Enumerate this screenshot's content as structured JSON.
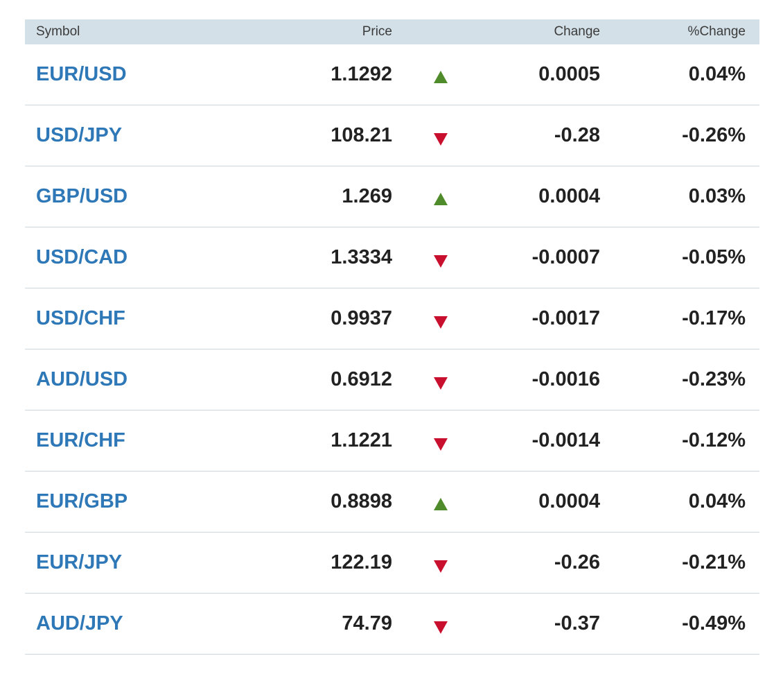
{
  "table": {
    "headers": {
      "symbol": "Symbol",
      "price": "Price",
      "change": "Change",
      "pct_change": "%Change"
    },
    "rows": [
      {
        "symbol": "EUR/USD",
        "price": "1.1292",
        "direction": "up",
        "change": "0.0005",
        "pct_change": "0.04%"
      },
      {
        "symbol": "USD/JPY",
        "price": "108.21",
        "direction": "down",
        "change": "-0.28",
        "pct_change": "-0.26%"
      },
      {
        "symbol": "GBP/USD",
        "price": "1.269",
        "direction": "up",
        "change": "0.0004",
        "pct_change": "0.03%"
      },
      {
        "symbol": "USD/CAD",
        "price": "1.3334",
        "direction": "down",
        "change": "-0.0007",
        "pct_change": "-0.05%"
      },
      {
        "symbol": "USD/CHF",
        "price": "0.9937",
        "direction": "down",
        "change": "-0.0017",
        "pct_change": "-0.17%"
      },
      {
        "symbol": "AUD/USD",
        "price": "0.6912",
        "direction": "down",
        "change": "-0.0016",
        "pct_change": "-0.23%"
      },
      {
        "symbol": "EUR/CHF",
        "price": "1.1221",
        "direction": "down",
        "change": "-0.0014",
        "pct_change": "-0.12%"
      },
      {
        "symbol": "EUR/GBP",
        "price": "0.8898",
        "direction": "up",
        "change": "0.0004",
        "pct_change": "0.04%"
      },
      {
        "symbol": "EUR/JPY",
        "price": "122.19",
        "direction": "down",
        "change": "-0.26",
        "pct_change": "-0.21%"
      },
      {
        "symbol": "AUD/JPY",
        "price": "74.79",
        "direction": "down",
        "change": "-0.37",
        "pct_change": "-0.49%"
      }
    ]
  },
  "colors": {
    "link": "#2e78b7",
    "up": "#4f8a2b",
    "down": "#c8102e",
    "header_bg": "#d3e0e8"
  },
  "icons": {
    "up": "triangle-up-icon",
    "down": "triangle-down-icon"
  }
}
